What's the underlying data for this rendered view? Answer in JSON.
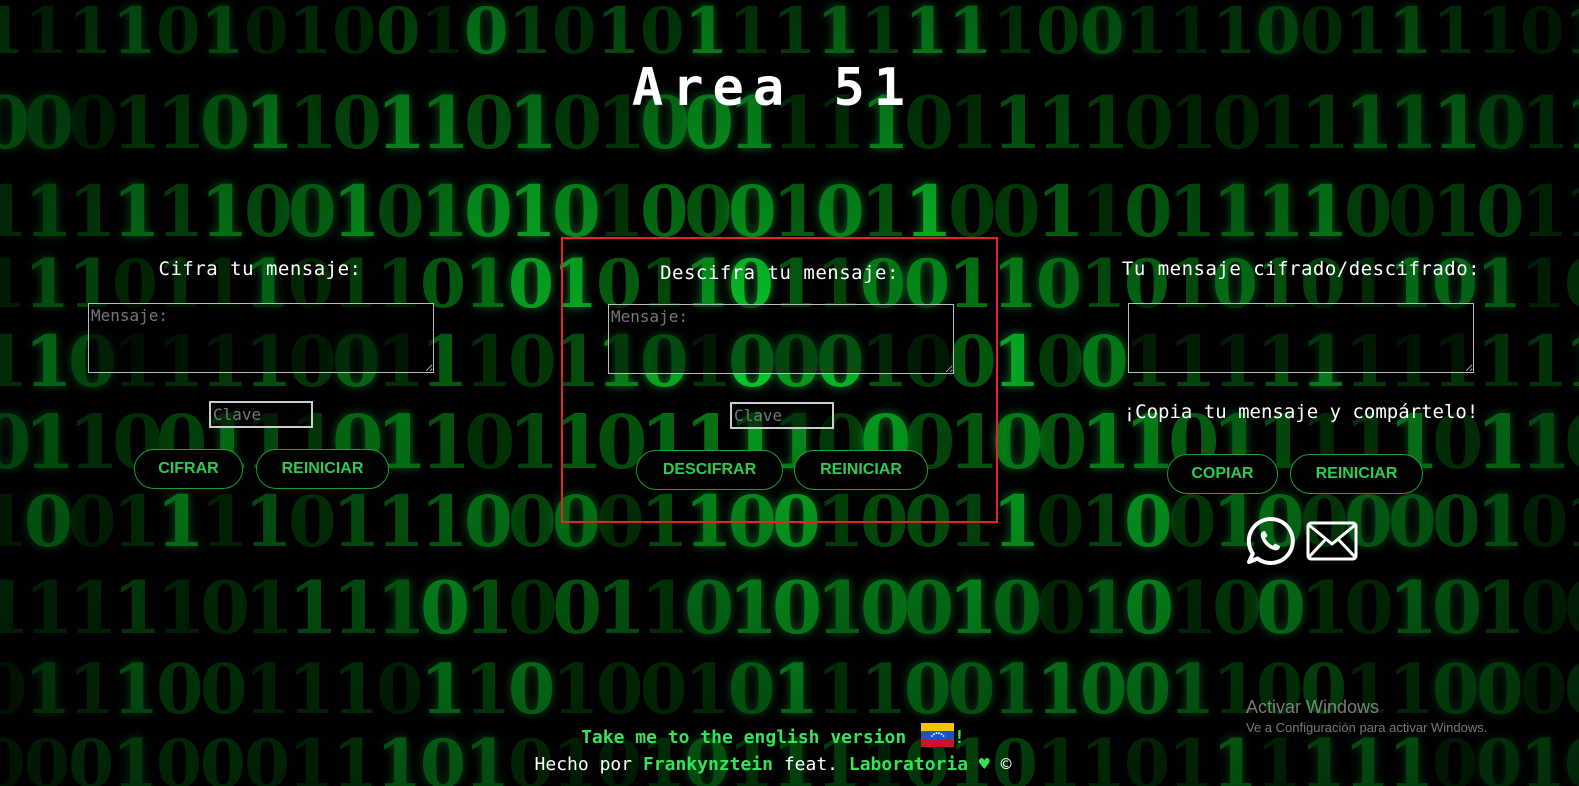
{
  "page": {
    "title": "Area 51"
  },
  "encrypt": {
    "heading": "Cifra tu mensaje:",
    "message_placeholder": "Mensaje:",
    "key_placeholder": "Clave",
    "encrypt_label": "CIFRAR",
    "reset_label": "REINICIAR"
  },
  "decrypt": {
    "heading": "Descifra tu mensaje:",
    "message_placeholder": "Mensaje:",
    "key_placeholder": "Clave",
    "decrypt_label": "DESCIFRAR",
    "reset_label": "REINICIAR",
    "highlight_color": "#e0262b"
  },
  "result": {
    "heading": "Tu mensaje cifrado/descifrado:",
    "output_value": "",
    "share_text": "¡Copia tu mensaje y compártelo!",
    "copy_label": "COPIAR",
    "reset_label": "REINICIAR",
    "share_icons": [
      "whatsapp-icon",
      "mail-icon"
    ]
  },
  "footer": {
    "english_link": "Take me to the english version",
    "exclamation": "!",
    "made_by_prefix": "Hecho por",
    "author": "Frankynztein",
    "feat": "feat.",
    "partner": "Laboratoria",
    "heart": "♥",
    "copyright": "©"
  },
  "watermark": {
    "line1": "Activar Windows",
    "line2": "Ve a Configuración para activar Windows."
  },
  "colors": {
    "accent_green": "#2ecc4f",
    "background": "#000000",
    "text": "#ffffff"
  }
}
